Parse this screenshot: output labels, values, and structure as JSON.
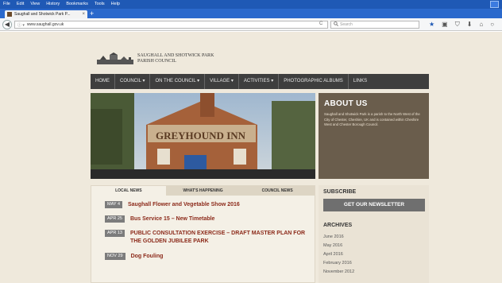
{
  "browser": {
    "menu": [
      "File",
      "Edit",
      "View",
      "History",
      "Bookmarks",
      "Tools",
      "Help"
    ],
    "tab_title": "Saughall and Shotwick Park P...",
    "tab_close": "×",
    "new_tab": "+",
    "back": "◀",
    "url_prefix": "ⓘ ▾",
    "url": "www.saughall.gov.uk",
    "reload": "C",
    "search_placeholder": "Search",
    "search_icon": "search-icon",
    "toolbar_icons": [
      "star-icon",
      "clipboard-icon",
      "shield-icon",
      "download-icon",
      "home-icon",
      "chat-icon"
    ]
  },
  "site": {
    "logo_line1": "SAUGHALL AND SHOTWICK PARK",
    "logo_line2": "PARISH COUNCIL",
    "nav": [
      "HOME",
      "COUNCIL ▾",
      "ON THE COUNCIL ▾",
      "VILLAGE ▾",
      "ACTIVITIES ▾",
      "PHOTOGRAPHIC ALBUMS",
      "LINKS"
    ],
    "about_title": "ABOUT US",
    "about_text": "Saughall and Shotwick Park is a parish to the North West of the City of Chester, Cheshire, UK and is contained within Cheshire West and Chester Borough Council.",
    "hero_sign": "GREYHOUND INN",
    "news_tabs": [
      "LOCAL NEWS",
      "WHAT'S HAPPENING",
      "COUNCIL NEWS"
    ],
    "news": [
      {
        "date": "MAY 4",
        "title": "Saughall Flower and Vegetable Show 2016"
      },
      {
        "date": "APR 25",
        "title": "Bus Service 15 – New Timetable"
      },
      {
        "date": "APR 13",
        "title": "PUBLIC CONSULTATION EXERCISE – DRAFT MASTER PLAN FOR THE GOLDEN JUBILEE PARK"
      },
      {
        "date": "NOV 29",
        "title": "Dog Fouling"
      }
    ],
    "subscribe_heading": "SUBSCRIBE",
    "newsletter_button": "GET OUR NEWSLETTER",
    "archives_heading": "ARCHIVES",
    "archives": [
      "June 2016",
      "May 2016",
      "April 2016",
      "February 2016",
      "November 2012"
    ]
  }
}
